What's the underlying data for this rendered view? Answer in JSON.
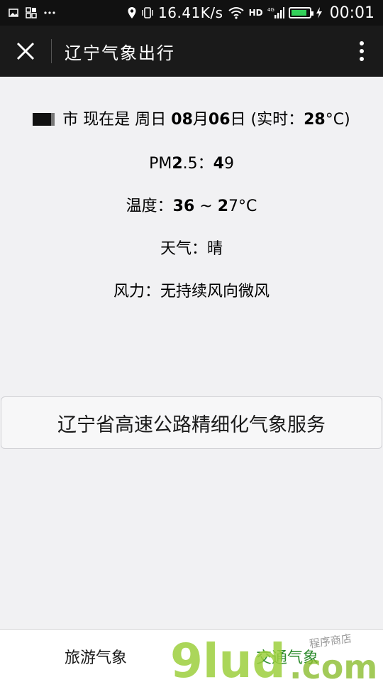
{
  "status_bar": {
    "speed": "16.41K/s",
    "hd_label": "HD",
    "time": "00:01",
    "battery_color": "#33d15a",
    "battery_level": 0.9
  },
  "title_bar": {
    "title": "辽宁气象出行",
    "close_icon": "close-icon",
    "more_icon": "more-vertical-icon"
  },
  "weather": {
    "city_suffix": "市 现在是 周日 ",
    "date": "08",
    "month_char": "月",
    "day": "06",
    "day_char": "日 (实时：",
    "realtime_temp": "28",
    "realtime_unit": "°C)",
    "pm_label": "PM",
    "pm_prefix_bold": "2",
    "pm_mid": ".5：",
    "pm_value_bold": "4",
    "pm_value_rest": "9",
    "temp_label": "温度：",
    "temp_high": "36",
    "temp_sep": " ~ ",
    "temp_low_bold": "2",
    "temp_low_rest": "7°C",
    "weather_line": "天气：晴",
    "wind_line": "风力：无持续风向微风"
  },
  "service_button": {
    "label": "辽宁省高速公路精细化气象服务"
  },
  "bottom_nav": {
    "left_label": "旅游气象",
    "right_label": "交通气象"
  },
  "watermark": {
    "logo_text": "9lud.com",
    "sub_text": "程序商店"
  }
}
